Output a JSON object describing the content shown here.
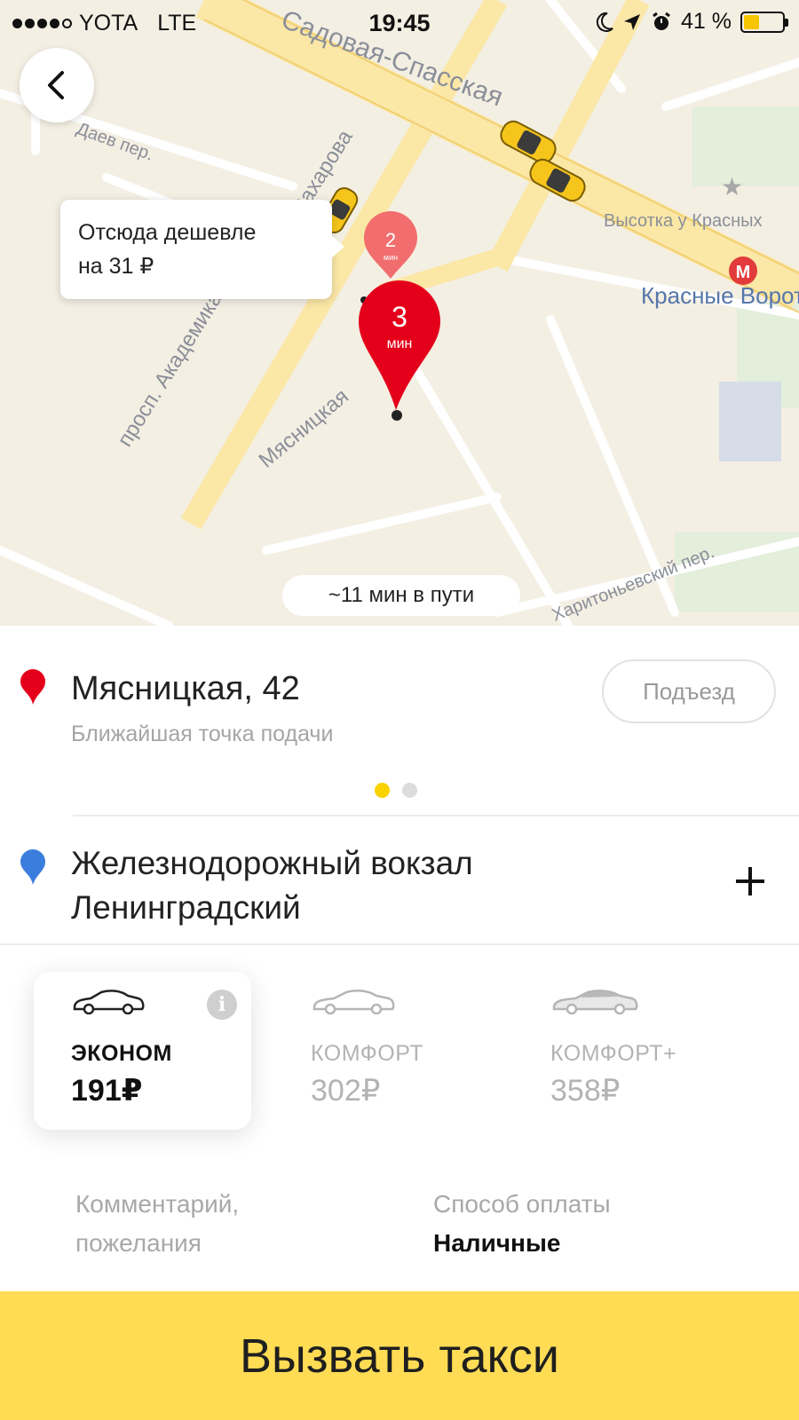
{
  "status_bar": {
    "carrier": "YOTA",
    "network": "LTE",
    "time": "19:45",
    "battery_percent": "41 %",
    "battery_level": 0.41,
    "icons": [
      "moon-icon",
      "location-arrow-icon",
      "alarm-icon"
    ]
  },
  "map": {
    "streets": {
      "sadovaya": "Садовая-Спасская",
      "daev": "Даев пер.",
      "sakharova": "Сахарова",
      "akademika": "просп. Академика",
      "myasnitskaya": "Мясницкая",
      "kharitonyevsky": "Харитоньевский пер.",
      "vysotka": "Высотка у Красных",
      "krasnye_vorota": "Красные Ворота",
      "metro": "М"
    },
    "tooltip": {
      "line1": "Отсюда дешевле",
      "line2": "на 31 ₽"
    },
    "pin_small": {
      "number": "2",
      "unit": "мин"
    },
    "pin_large": {
      "number": "3",
      "unit": "мин"
    },
    "route_time": "~11 мин в пути"
  },
  "pickup": {
    "address": "Мясницкая, 42",
    "subtitle": "Ближайшая точка подачи",
    "entrance_label": "Подъезд",
    "page_count": 2,
    "active_page": 1
  },
  "destination": {
    "line1": "Железнодорожный вокзал",
    "line2": "Ленинградский"
  },
  "tariffs": [
    {
      "name": "ЭКОНОМ",
      "price": "191₽",
      "selected": true
    },
    {
      "name": "КОМФОРТ",
      "price": "302₽",
      "selected": false
    },
    {
      "name": "КОМФОРТ+",
      "price": "358₽",
      "selected": false
    }
  ],
  "options": {
    "comment_line1": "Комментарий,",
    "comment_line2": "пожелания",
    "payment_label": "Способ оплаты",
    "payment_value": "Наличные"
  },
  "call_button": "Вызвать такси",
  "colors": {
    "accent_yellow": "#ffdc54",
    "pin_red": "#e4001a",
    "pin_blue": "#3b7ddd",
    "map_background": "#f4efe3",
    "road_yellow": "#fbe7a6"
  }
}
